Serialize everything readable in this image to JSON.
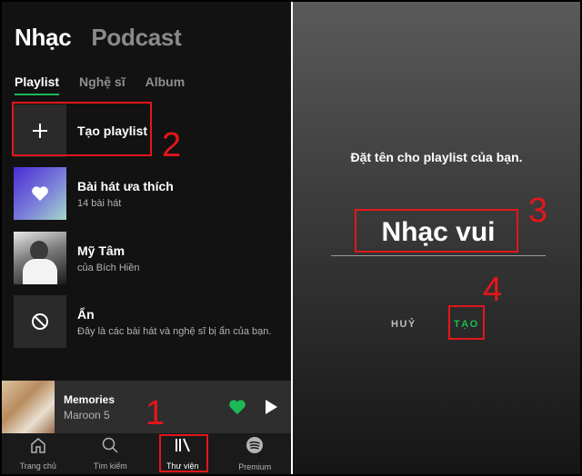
{
  "library": {
    "top_tabs": [
      "Nhạc",
      "Podcast"
    ],
    "sub_tabs": [
      "Playlist",
      "Nghệ sĩ",
      "Album"
    ],
    "items": [
      {
        "title": "Tạo playlist",
        "subtitle": "",
        "icon": "plus-icon"
      },
      {
        "title": "Bài hát ưa thích",
        "subtitle": "14 bài hát",
        "icon": "heart-icon"
      },
      {
        "title": "Mỹ Tâm",
        "subtitle": "của Bích Hiền",
        "icon": "artist-photo"
      },
      {
        "title": "Ẩn",
        "subtitle": "Đây là các bài hát và nghệ sĩ bị ẩn của bạn.",
        "icon": "block-icon"
      }
    ]
  },
  "now_playing": {
    "title": "Memories",
    "artist": "Maroon 5"
  },
  "bottom_nav": [
    {
      "label": "Trang chủ",
      "icon": "home-icon"
    },
    {
      "label": "Tìm kiếm",
      "icon": "search-icon"
    },
    {
      "label": "Thư viện",
      "icon": "library-icon",
      "active": true
    },
    {
      "label": "Premium",
      "icon": "spotify-icon"
    }
  ],
  "dialog": {
    "prompt": "Đặt tên cho playlist của bạn.",
    "input_value": "Nhạc vui",
    "cancel_label": "HUỶ",
    "create_label": "TẠO"
  },
  "annotations": [
    "1",
    "2",
    "3",
    "4"
  ],
  "colors": {
    "accent": "#1db954",
    "annotation": "#e3161b",
    "background": "#121212"
  }
}
